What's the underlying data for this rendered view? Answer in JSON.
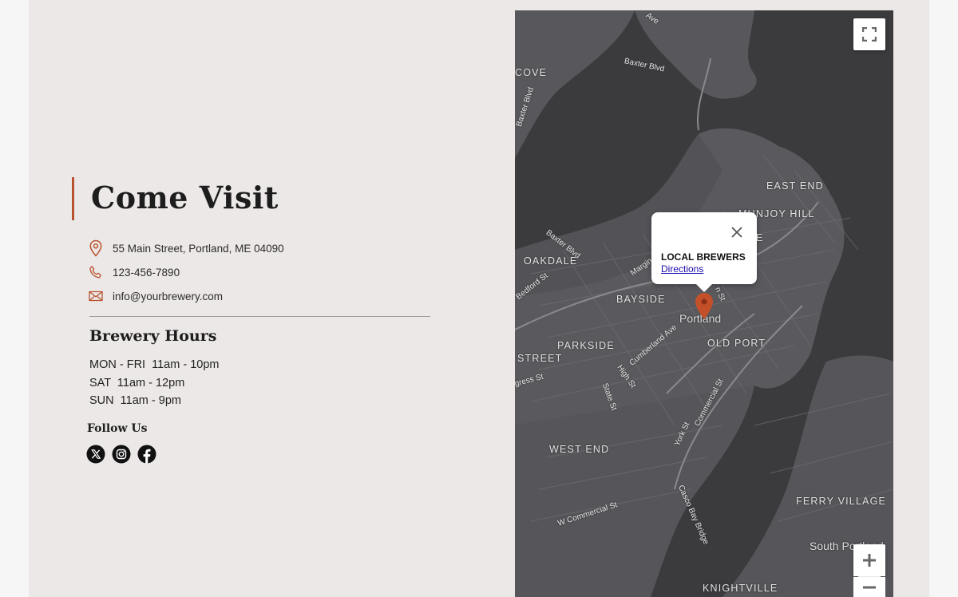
{
  "contact": {
    "title": "Come Visit",
    "address": "55 Main Street, Portland, ME 04090",
    "phone": "123-456-7890",
    "email": "info@yourbrewery.com",
    "icons": {
      "address": "map-pin-icon",
      "phone": "phone-icon",
      "email": "email-icon"
    },
    "accent_color": "#b9532f"
  },
  "hours": {
    "title": "Brewery Hours",
    "lines": [
      "MON - FRI  11am - 10pm",
      "SAT  11am - 12pm",
      "SUN  11am - 9pm"
    ]
  },
  "social": {
    "title": "Follow Us",
    "links": [
      {
        "name": "x",
        "icon": "x-icon"
      },
      {
        "name": "instagram",
        "icon": "instagram-icon"
      },
      {
        "name": "facebook",
        "icon": "facebook-icon"
      }
    ]
  },
  "map": {
    "popup": {
      "title": "LOCAL BREWERS",
      "link": "Directions"
    },
    "marker_color": "#c4502a",
    "city_label": "Portland",
    "corner_label": "South Portland",
    "neighborhoods": [
      "COVE",
      "EAST END",
      "MUNJOY HILL",
      "OAKDALE",
      "BAYSIDE",
      "PARKSIDE",
      "OLD PORT",
      "STREET",
      "WEST END",
      "FERRY VILLAGE",
      "KNIGHTVILLE",
      "E"
    ],
    "streets": [
      "Baxter Blvd",
      "Baxter Blvd",
      "Baxter Blvd",
      "Bedford St",
      "Cumberland Ave",
      "High St",
      "State St",
      "Commercial St",
      "York St",
      "Casco Bay Bridge",
      "W Commercial St",
      "Margin",
      "n St",
      "gress St",
      "Ave"
    ]
  }
}
